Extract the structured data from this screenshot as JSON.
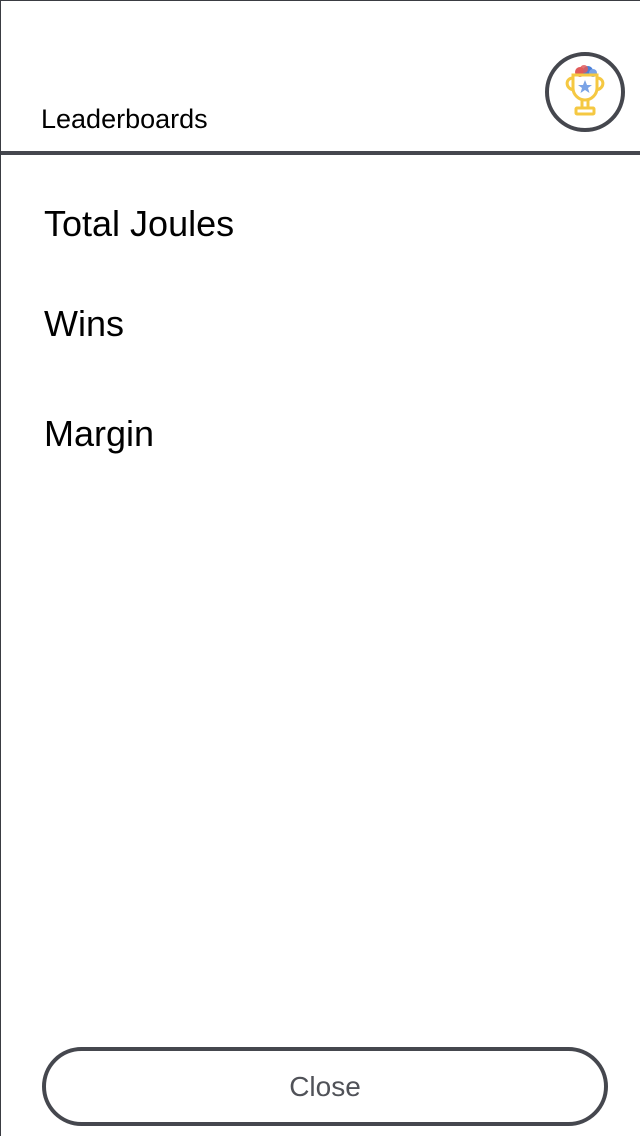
{
  "header": {
    "title": "Leaderboards",
    "badge_icon": "trophy-icon"
  },
  "leaderboards": {
    "items": [
      {
        "label": "Total Joules"
      },
      {
        "label": "Wins"
      },
      {
        "label": "Margin"
      }
    ]
  },
  "footer": {
    "close_label": "Close"
  },
  "colors": {
    "border": "#45474e",
    "trophy_gold": "#f5c842",
    "trophy_star": "#7aa3e6",
    "confetti_red": "#e05a5a",
    "confetti_blue": "#4a7fd9",
    "text": "#000000",
    "button_text": "#505258"
  }
}
